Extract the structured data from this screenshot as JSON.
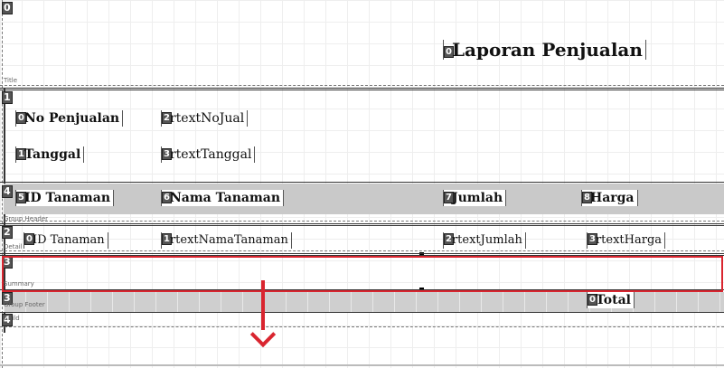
{
  "bands": {
    "title": {
      "index": "0",
      "label": "Title"
    },
    "header": {
      "index": "1",
      "label": ""
    },
    "group_header": {
      "index": "4",
      "label": "Group Header"
    },
    "detail": {
      "index": "2",
      "label": "Detail"
    },
    "summary": {
      "index": "3",
      "label": "Summary"
    },
    "group_footer": {
      "index": "3",
      "label": "Group Footer"
    },
    "child": {
      "index": "4",
      "label": "Child"
    }
  },
  "title_field": {
    "index": "0",
    "text": "Laporan Penjualan"
  },
  "header_fields": [
    {
      "index": "0",
      "text": "No Penjualan"
    },
    {
      "index": "2",
      "text": "rtextNoJual"
    },
    {
      "index": "1",
      "text": "Tanggal"
    },
    {
      "index": "3",
      "text": "rtextTanggal"
    }
  ],
  "group_header_fields": [
    {
      "index": "5",
      "text": "ID Tanaman"
    },
    {
      "index": "6",
      "text": "Nama Tanaman"
    },
    {
      "index": "7",
      "text": "Jumlah"
    },
    {
      "index": "8",
      "text": "Harga"
    }
  ],
  "detail_fields": [
    {
      "index": "0",
      "text": "ID Tanaman"
    },
    {
      "index": "1",
      "text": "rtextNamaTanaman"
    },
    {
      "index": "2",
      "text": "rtextJumlah"
    },
    {
      "index": "3",
      "text": "rtextHarga"
    }
  ],
  "footer_fields": [
    {
      "index": "0",
      "text": "Total"
    }
  ],
  "colors": {
    "highlight": "#d9252f",
    "band_gray": "#c9c9c9"
  }
}
